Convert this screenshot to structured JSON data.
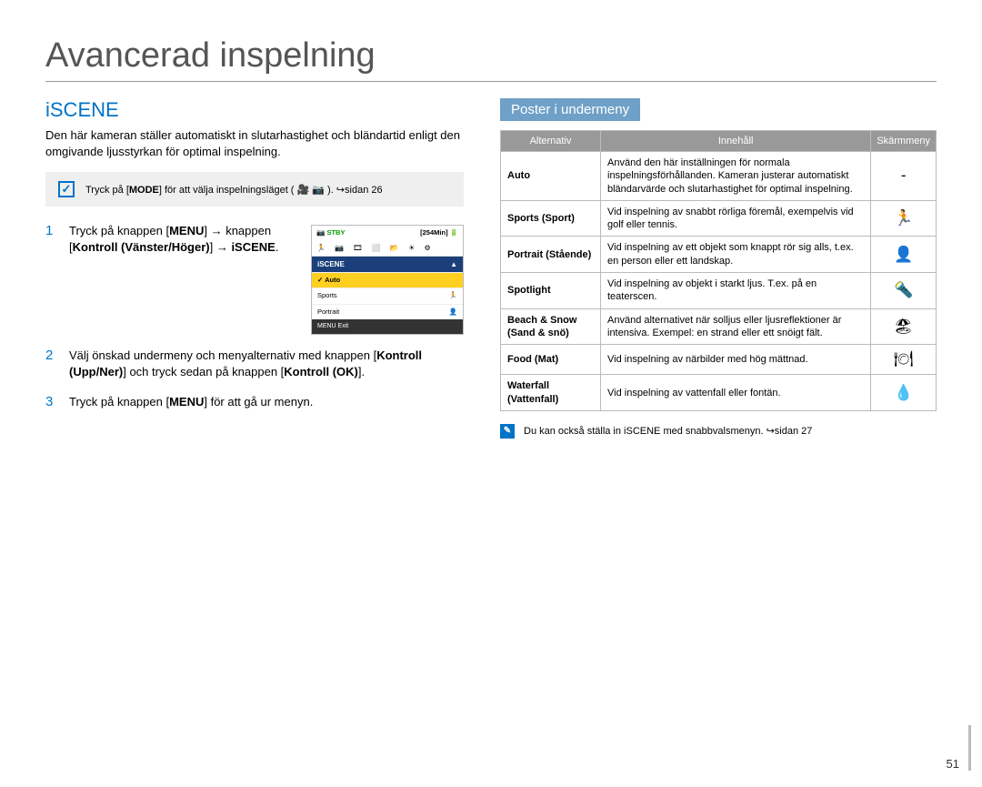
{
  "title": "Avancerad inspelning",
  "section": "iSCENE",
  "intro": "Den här kameran ställer automatiskt in slutarhastighet och bländartid enligt den omgivande ljusstyrkan för optimal inspelning.",
  "tip": {
    "prefix": "Tryck på [",
    "mode": "MODE",
    "middle": "] för att välja inspelningsläget ( 🎥 📷 ). ↪sidan 26"
  },
  "steps": [
    {
      "num": "1",
      "segments": [
        "Tryck på knappen [",
        "MENU",
        "] → knappen [",
        "Kontroll (Vänster/Höger)",
        "] → ",
        "iSCENE",
        "."
      ]
    },
    {
      "num": "2",
      "segments": [
        "Välj önskad undermeny och menyalternativ med knappen [",
        "Kontroll (Upp/Ner)",
        "] och tryck sedan på knappen [",
        "Kontroll (OK)",
        "]."
      ]
    },
    {
      "num": "3",
      "segments": [
        "Tryck på knappen [",
        "MENU",
        "] för att gå ur menyn."
      ]
    }
  ],
  "deviceScreen": {
    "stby": "STBY",
    "time": "[254Min]",
    "tabhead_left": "iSCENE",
    "tabhead_right": "▲",
    "rows": [
      {
        "label": "Auto",
        "icon": "✓",
        "sel": true
      },
      {
        "label": "Sports",
        "icon": "🏃",
        "sel": false
      },
      {
        "label": "Portrait",
        "icon": "👤",
        "sel": false
      }
    ],
    "exit": "MENU Exit"
  },
  "submenuTitle": "Poster i undermeny",
  "tableHeaders": {
    "opt": "Alternativ",
    "content": "Innehåll",
    "screen": "Skärmmeny"
  },
  "tableRows": [
    {
      "opt": "Auto",
      "content": "Använd den här inställningen för normala inspelningsförhållanden. Kameran justerar automatiskt bländarvärde och slutarhastighet för optimal inspelning.",
      "icon": "-"
    },
    {
      "opt": "Sports (Sport)",
      "content": "Vid inspelning av snabbt rörliga föremål, exempelvis vid golf eller tennis.",
      "icon": "🏃"
    },
    {
      "opt": "Portrait (Stående)",
      "content": "Vid inspelning av ett objekt som knappt rör sig alls, t.ex. en person eller ett landskap.",
      "icon": "👤"
    },
    {
      "opt": "Spotlight",
      "content": "Vid inspelning av objekt i starkt ljus. T.ex. på en teaterscen.",
      "icon": "🔦"
    },
    {
      "opt": "Beach & Snow (Sand & snö)",
      "content": "Använd alternativet när solljus eller ljusreflektioner är intensiva. Exempel: en strand eller ett snöigt fält.",
      "icon": "🏖"
    },
    {
      "opt": "Food (Mat)",
      "content": "Vid inspelning av närbilder med hög mättnad.",
      "icon": "🍽"
    },
    {
      "opt": "Waterfall (Vattenfall)",
      "content": "Vid inspelning av vattenfall eller fontän.",
      "icon": "💧"
    }
  ],
  "note": "Du kan också ställa in iSCENE med snabbvalsmenyn. ↪sidan 27",
  "pageNumber": "51"
}
